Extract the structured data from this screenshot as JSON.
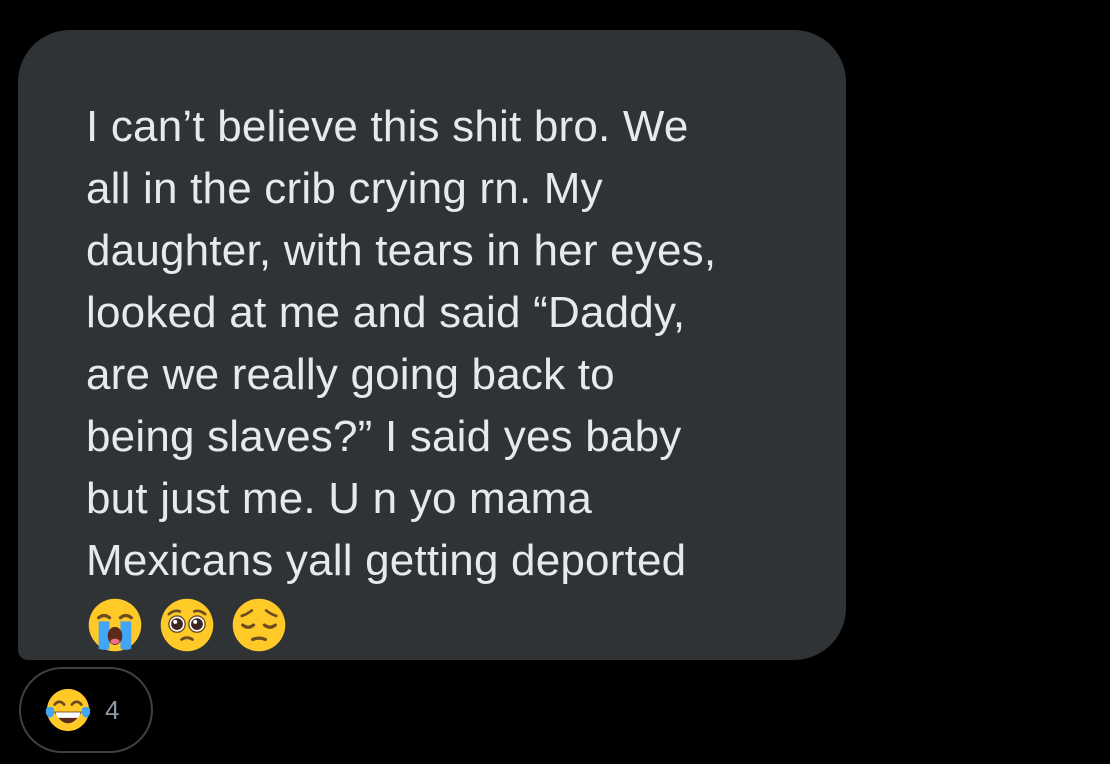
{
  "message": {
    "lines": [
      "I can’t believe this shit bro. We",
      "all in the crib crying rn. My",
      "daughter, with tears in her eyes,",
      "looked at me and said “Daddy,",
      "are we really going back to",
      "being slaves?” I said yes baby",
      "but just me. U n yo mama",
      "Mexicans yall getting deported"
    ],
    "emojis": [
      "loudly-crying-face",
      "pleading-face",
      "pensive-face"
    ]
  },
  "reaction": {
    "emoji": "face-with-tears-of-joy",
    "count": "4"
  },
  "colors": {
    "background": "#000000",
    "bubble": "#2f3336",
    "text": "#e7e9ea",
    "pill_border": "#3e4144",
    "count_text": "#8b98a5"
  }
}
